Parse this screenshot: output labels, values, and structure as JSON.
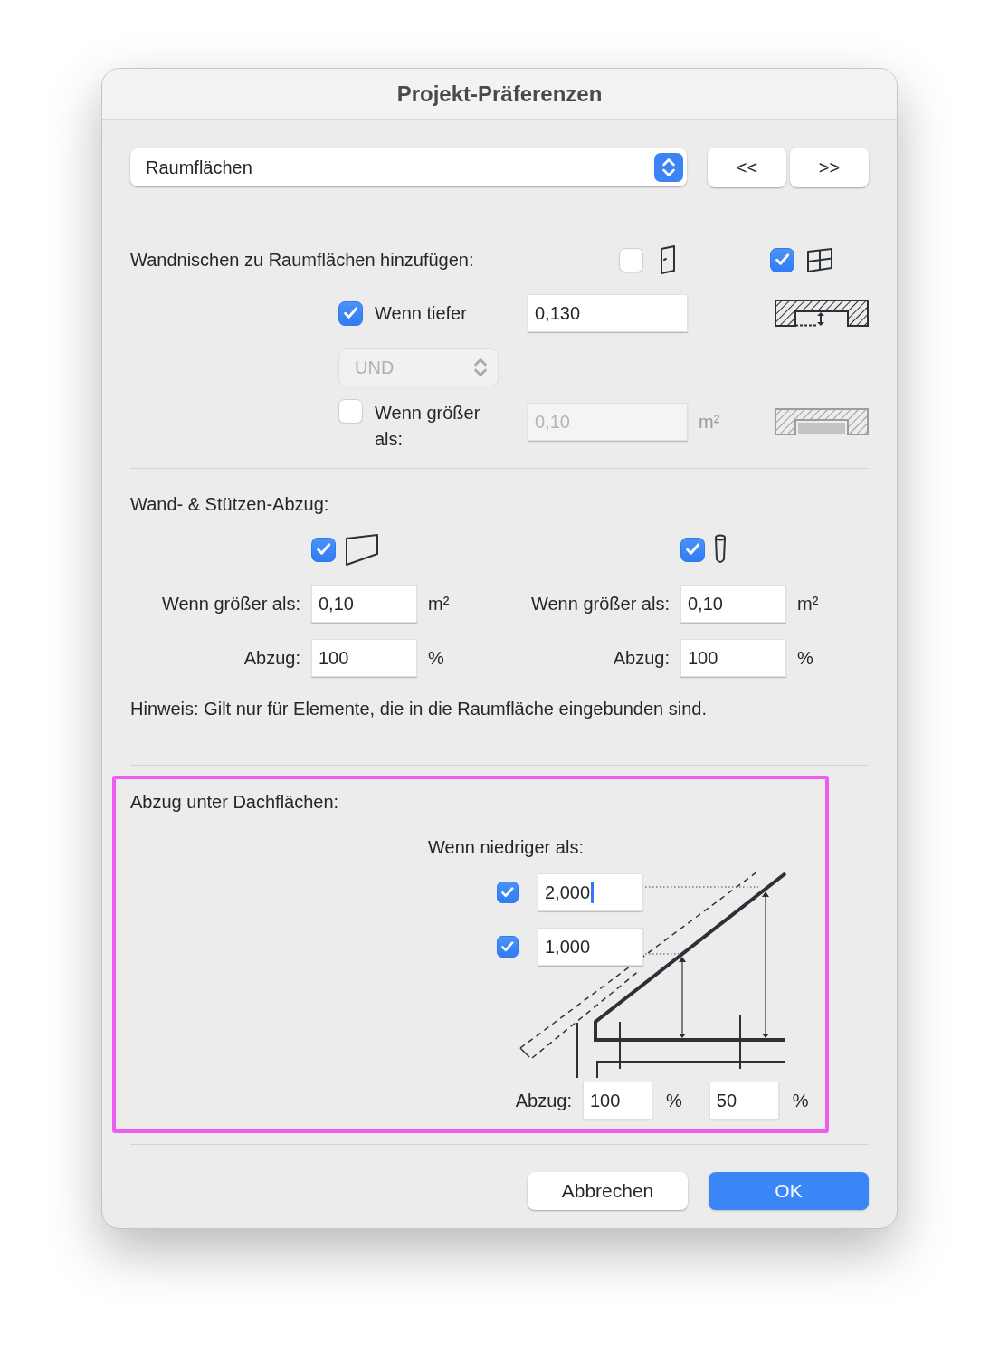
{
  "window": {
    "title": "Projekt-Präferenzen"
  },
  "header": {
    "category": {
      "value": "Raumflächen"
    },
    "nav_buttons": [
      {
        "label": "<<"
      },
      {
        "label": ">>"
      }
    ]
  },
  "niches": {
    "label": "Wandnischen zu Raumflächen hinzufügen:",
    "options": [
      {
        "kind": "door",
        "checked": false
      },
      {
        "kind": "window",
        "checked": true
      }
    ],
    "depth": {
      "checked": true,
      "label": "Wenn tiefer",
      "value": "0,130",
      "disabled": false
    },
    "operator": {
      "value": "UND",
      "disabled": true
    },
    "area": {
      "checked": false,
      "label": "Wenn größer als:",
      "value": "0,10",
      "unit": "m²",
      "disabled": true
    }
  },
  "deductions": {
    "label": "Wand- & Stützen-Abzug:",
    "columns": [
      {
        "kind": "wall",
        "checked": true,
        "area_label": "Wenn größer als:",
        "area_value": "0,10",
        "area_unit": "m²",
        "deduct_label": "Abzug:",
        "deduct_value": "100",
        "deduct_unit": "%"
      },
      {
        "kind": "column",
        "checked": true,
        "area_label": "Wenn größer als:",
        "area_value": "0,10",
        "area_unit": "m²",
        "deduct_label": "Abzug:",
        "deduct_value": "100",
        "deduct_unit": "%"
      }
    ],
    "note": "Hinweis: Gilt nur für Elemente, die in die Raumfläche eingebunden sind."
  },
  "roof": {
    "highlighted": true,
    "label": "Abzug unter Dachflächen:",
    "heights_label": "Wenn niedriger als:",
    "heights": [
      {
        "checked": true,
        "value": "2,000",
        "focused": true
      },
      {
        "checked": true,
        "value": "1,000",
        "focused": false
      }
    ],
    "deduct_label": "Abzug:",
    "deductions": [
      {
        "value": "100",
        "unit": "%"
      },
      {
        "value": "50",
        "unit": "%"
      }
    ]
  },
  "footer": {
    "buttons": [
      {
        "label": "Abbrechen",
        "kind": "secondary"
      },
      {
        "label": "OK",
        "kind": "primary"
      }
    ]
  }
}
